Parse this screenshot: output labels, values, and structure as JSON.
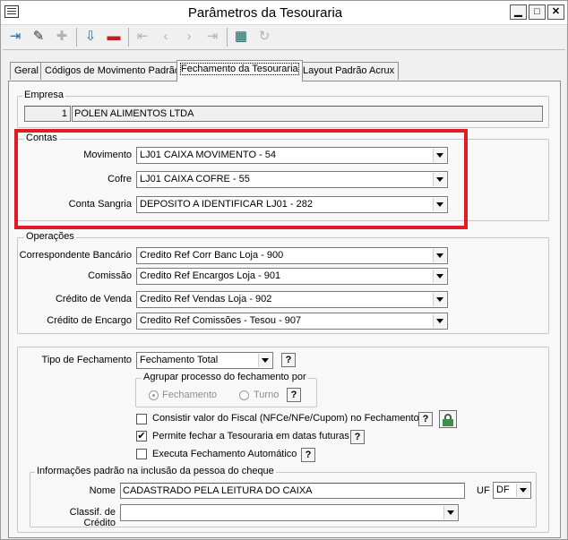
{
  "window": {
    "title": "Parâmetros da Tesouraria"
  },
  "tabs": [
    {
      "label": "Geral"
    },
    {
      "label": "Códigos de Movimento Padrão"
    },
    {
      "label": "Fechamento da Tesouraria"
    },
    {
      "label": "Layout Padrão Acrux"
    }
  ],
  "empresa": {
    "legend": "Empresa",
    "codigo": "1",
    "nome": "POLEN ALIMENTOS LTDA"
  },
  "contas": {
    "legend": "Contas",
    "movimento": {
      "label": "Movimento",
      "value": "LJ01 CAIXA MOVIMENTO - 54"
    },
    "cofre": {
      "label": "Cofre",
      "value": "LJ01 CAIXA COFRE - 55"
    },
    "sangria": {
      "label": "Conta Sangria",
      "value": "DEPOSITO A IDENTIFICAR LJ01 - 282"
    }
  },
  "operacoes": {
    "legend": "Operações",
    "correspondente": {
      "label": "Correspondente Bancário",
      "value": "Credito Ref Corr Banc Loja - 900"
    },
    "comissao": {
      "label": "Comissão",
      "value": "Credito Ref Encargos Loja - 901"
    },
    "venda": {
      "label": "Crédito de Venda",
      "value": "Credito Ref Vendas Loja - 902"
    },
    "encargo": {
      "label": "Crédito de Encargo",
      "value": "Credito Ref Comissões - Tesou - 907"
    }
  },
  "fechamento": {
    "tipo_label": "Tipo de Fechamento",
    "tipo_value": "Fechamento Total",
    "help": "?",
    "agrupar": {
      "legend": "Agrupar processo do fechamento por",
      "opt1": "Fechamento",
      "opt2": "Turno"
    },
    "consistir": {
      "label": "Consistir valor do Fiscal (NFCe/NFe/Cupom) no Fechamento",
      "checked": false
    },
    "permite": {
      "label": "Permite fechar a Tesouraria em datas futuras",
      "checked": true,
      "mark": "✔"
    },
    "executa": {
      "label": "Executa Fechamento Automático",
      "checked": false
    }
  },
  "info": {
    "legend": "Informações padrão na inclusão da pessoa do cheque",
    "nome_label": "Nome",
    "nome_value": "CADASTRADO PELA LEITURA DO CAIXA",
    "uf_label": "UF",
    "uf_value": "DF",
    "classif_label": "Classif. de Crédito",
    "classif_value": ""
  },
  "icons": [
    "exit-icon",
    "edit-icon",
    "add-icon",
    "save-icon",
    "delete-icon",
    "first-icon",
    "prev-icon",
    "next-icon",
    "last-icon",
    "grid-icon",
    "refresh-icon",
    "lock-icon"
  ],
  "colors": {
    "highlight": "#e01b24"
  }
}
